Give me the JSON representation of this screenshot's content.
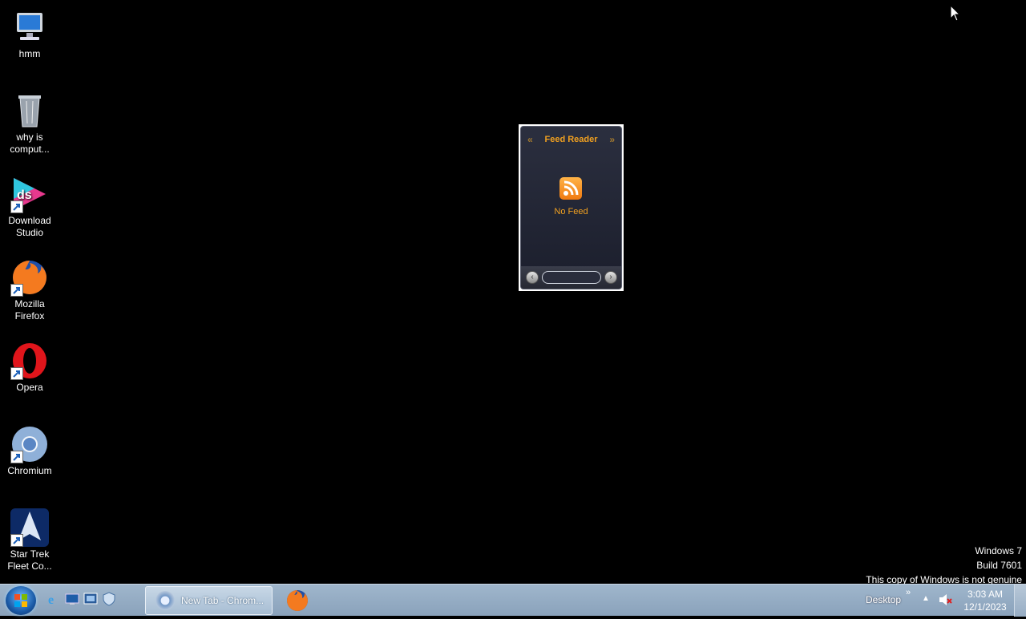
{
  "desktop": {
    "icons": [
      {
        "label": "hmm",
        "icon": "computer-icon"
      },
      {
        "label": "why is comput...",
        "icon": "recycle-bin-icon"
      },
      {
        "label": "Download Studio",
        "icon": "download-studio-icon"
      },
      {
        "label": "Mozilla Firefox",
        "icon": "firefox-icon"
      },
      {
        "label": "Opera",
        "icon": "opera-icon"
      },
      {
        "label": "Chromium",
        "icon": "chromium-icon"
      },
      {
        "label": "Star Trek Fleet Co...",
        "icon": "star-trek-icon"
      }
    ]
  },
  "gadget": {
    "title": "Feed Reader",
    "prev": "«",
    "next": "»",
    "status": "No Feed"
  },
  "watermark": {
    "line1": "Windows 7",
    "line2": "Build 7601",
    "line3": "This copy of Windows is not genuine"
  },
  "taskbar": {
    "task_label": "New Tab - Chrom...",
    "tray_desktop": "Desktop",
    "tray_chevron": "»",
    "time": "3:03 AM",
    "date": "12/1/2023"
  },
  "colors": {
    "accent": "#f0a020",
    "taskbar": "#9fb6cc"
  }
}
